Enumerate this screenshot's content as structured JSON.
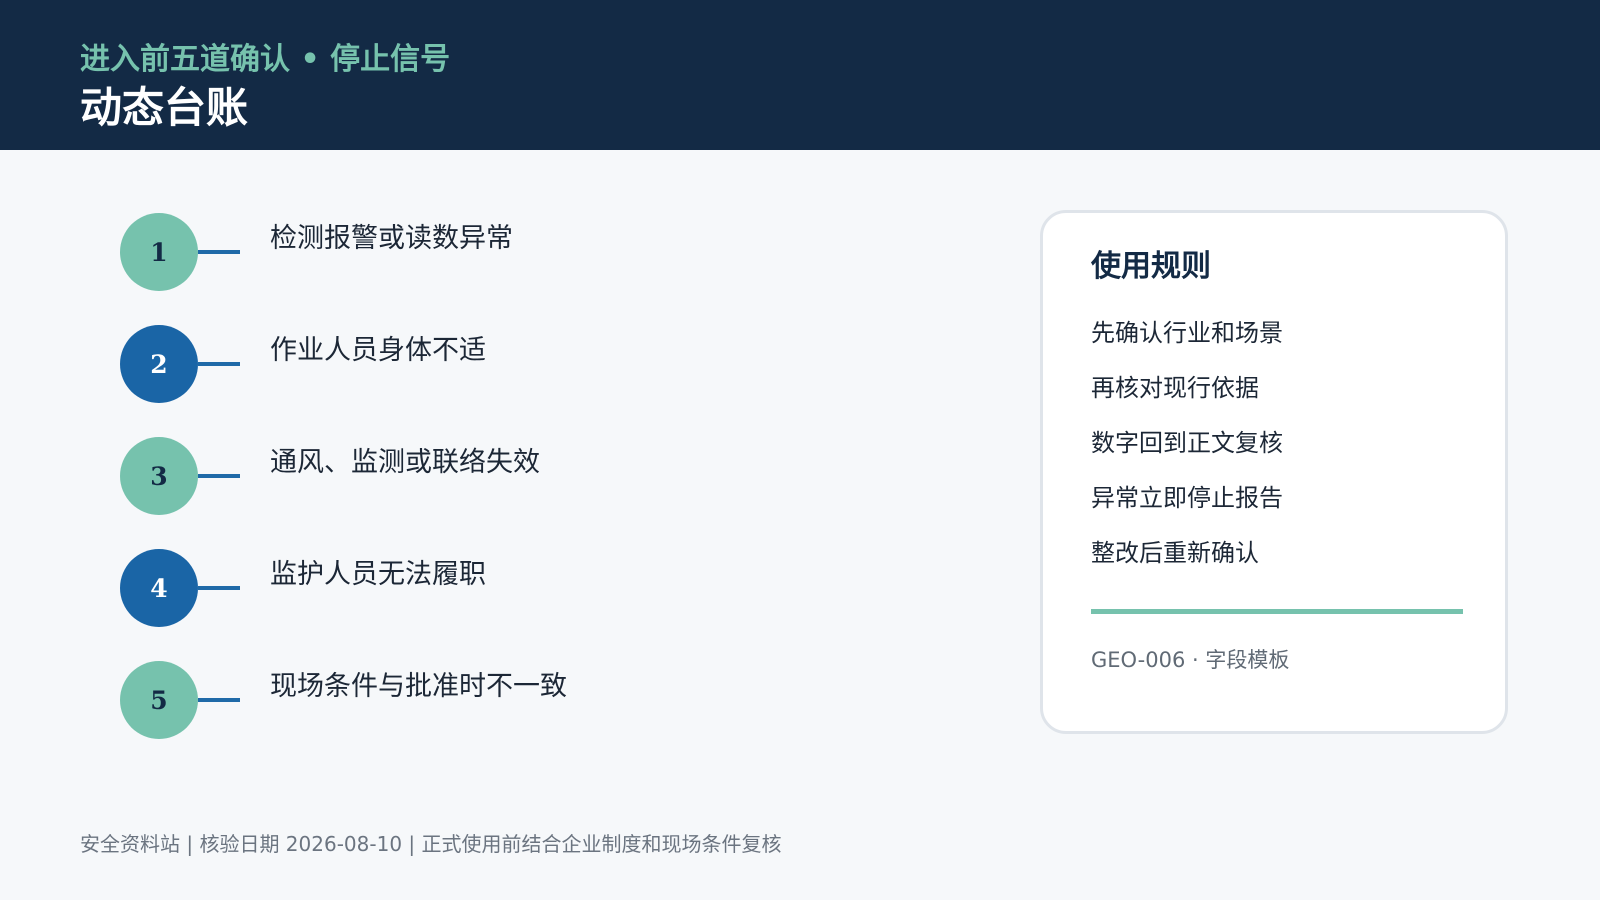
{
  "header": {
    "subtitle": "进入前五道确认 • 停止信号",
    "title": "动态台账"
  },
  "steps": [
    {
      "number": "1",
      "label": "检测报警或读数异常",
      "color": "#76c2ad"
    },
    {
      "number": "2",
      "label": "作业人员身体不适",
      "color": "#1a65a6"
    },
    {
      "number": "3",
      "label": "通风、监测或联络失效",
      "color": "#76c2ad"
    },
    {
      "number": "4",
      "label": "监护人员无法履职",
      "color": "#1a65a6"
    },
    {
      "number": "5",
      "label": "现场条件与批准时不一致",
      "color": "#76c2ad"
    }
  ],
  "rules_card": {
    "title": "使用规则",
    "rules": [
      "先确认行业和场景",
      "再核对现行依据",
      "数字回到正文复核",
      "异常立即停止报告",
      "整改后重新确认"
    ],
    "code": "GEO-006 · 字段模板"
  },
  "footer": {
    "text": "安全资料站 | 核验日期 2026-08-10 | 正式使用前结合企业制度和现场条件复核"
  },
  "colors": {
    "header_bg": "#132a45",
    "accent_teal": "#76c2ad",
    "accent_blue": "#1a65a6"
  }
}
